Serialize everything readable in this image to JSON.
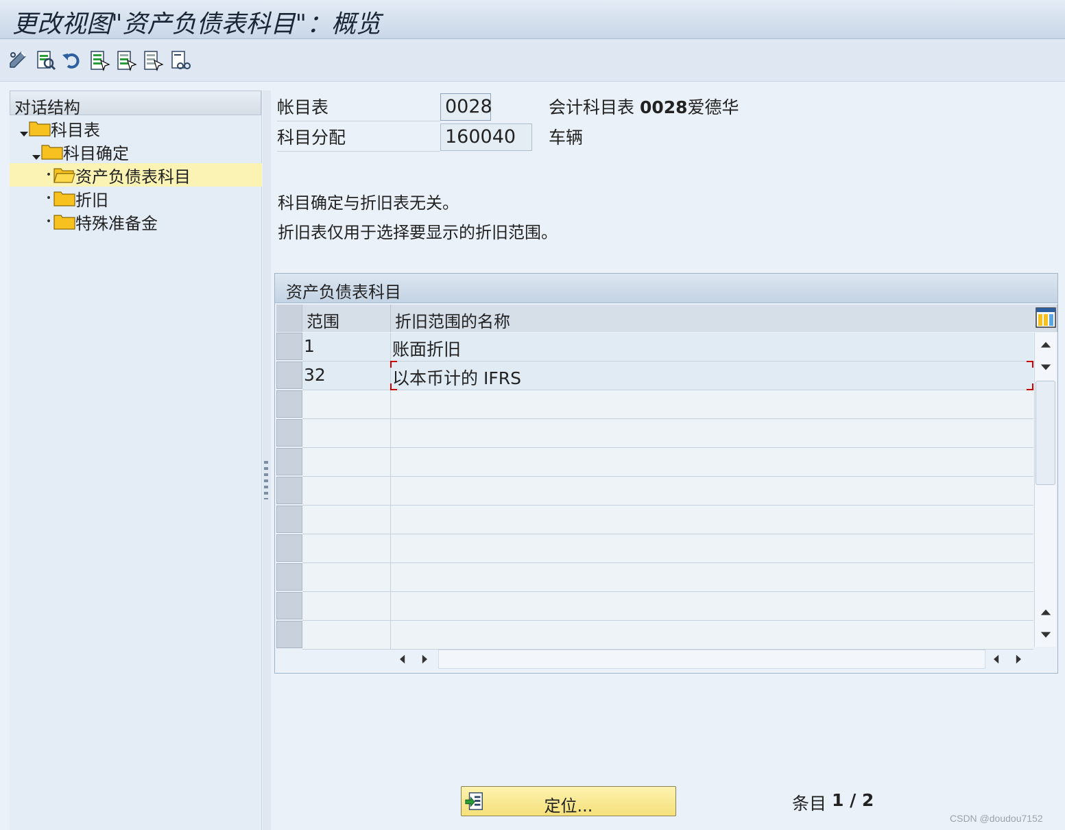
{
  "window": {
    "title": "更改视图\"资产负债表科目\"：概览"
  },
  "toolbar": {
    "buttons": [
      {
        "name": "edit-toggle-icon"
      },
      {
        "name": "details-icon"
      },
      {
        "name": "undo-icon"
      },
      {
        "name": "select-all-icon"
      },
      {
        "name": "select-block-icon"
      },
      {
        "name": "deselect-all-icon"
      },
      {
        "name": "print-preview-icon"
      }
    ]
  },
  "dialog_structure": {
    "header": "对话结构",
    "items": [
      {
        "label": "科目表",
        "level": 0,
        "expanded": true
      },
      {
        "label": "科目确定",
        "level": 1,
        "expanded": true
      },
      {
        "label": "资产负债表科目",
        "level": 2,
        "selected": true
      },
      {
        "label": "折旧",
        "level": 2
      },
      {
        "label": "特殊准备金",
        "level": 2
      }
    ]
  },
  "fields": {
    "chart_of_accounts": {
      "label": "帐目表",
      "value": "0028",
      "desc_prefix": "会计科目表 ",
      "desc_bold": "0028",
      "desc_suffix": "爱德华"
    },
    "account_assignment": {
      "label": "科目分配",
      "value": "160040",
      "desc": "车辆"
    }
  },
  "info": {
    "line1": "科目确定与折旧表无关。",
    "line2": "折旧表仅用于选择要显示的折旧范围。"
  },
  "table": {
    "title": "资产负债表科目",
    "columns": [
      "范围",
      "折旧范围的名称"
    ],
    "rows": [
      {
        "area": "1",
        "name": "账面折旧"
      },
      {
        "area": "32",
        "name": "以本币计的 IFRS"
      }
    ],
    "empty_rows": 9
  },
  "footer": {
    "locate_label": "定位...",
    "entry_label": "条目",
    "entry_value": "1 / 2"
  },
  "watermark": "CSDN @doudou7152",
  "colors": {
    "accent_yellow": "#f5e07a",
    "folder_yellow": "#f7c21f",
    "selected_row": "#fbf3b4",
    "background": "#eaf1f8"
  }
}
